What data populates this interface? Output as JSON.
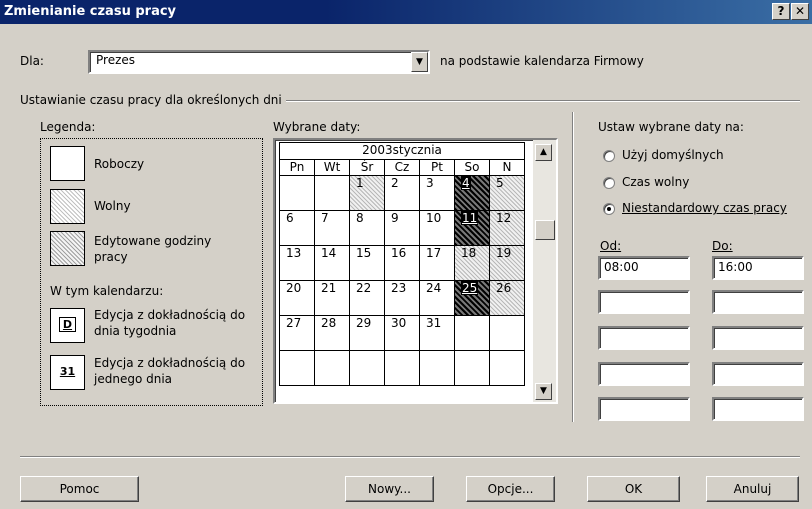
{
  "window": {
    "title": "Zmienianie czasu pracy",
    "help_btn": "?",
    "close_btn": "✕"
  },
  "for_row": {
    "label": "Dla:",
    "value": "Prezes",
    "based_on": "na podstawie kalendarza Firmowy"
  },
  "section_title": "Ustawianie czasu pracy dla określonych dni",
  "legend": {
    "title": "Legenda:",
    "working": "Roboczy",
    "nonworking": "Wolny",
    "edited_line1": "Edytowane godziny",
    "edited_line2": "pracy",
    "in_calendar": "W tym kalendarzu:",
    "day_of_week_sample": "D",
    "day_of_week_line1": "Edycja z dokładnością do",
    "day_of_week_line2": "dnia tygodnia",
    "single_day_sample": "31",
    "single_day_line1": "Edycja z dokładnością do",
    "single_day_line2": "jednego dnia"
  },
  "selected_dates": {
    "title": "Wybrane daty:",
    "month": "2003stycznia",
    "weekdays": [
      "Pn",
      "Wt",
      "Śr",
      "Cz",
      "Pt",
      "So",
      "N"
    ],
    "weeks": [
      [
        "",
        "",
        "1",
        "2",
        "3",
        "4",
        "5"
      ],
      [
        "6",
        "7",
        "8",
        "9",
        "10",
        "11",
        "12"
      ],
      [
        "13",
        "14",
        "15",
        "16",
        "17",
        "18",
        "19"
      ],
      [
        "20",
        "21",
        "22",
        "23",
        "24",
        "25",
        "26"
      ],
      [
        "27",
        "28",
        "29",
        "30",
        "31",
        "",
        ""
      ],
      [
        "",
        "",
        "",
        "",
        "",
        "",
        ""
      ]
    ]
  },
  "set_dates": {
    "title": "Ustaw wybrane daty na:",
    "opt_default": "Użyj domyślnych",
    "opt_nonworking": "Czas wolny",
    "opt_custom": "Niestandardowy czas pracy",
    "from_label": "Od:",
    "to_label": "Do:",
    "from_values": [
      "08:00",
      "",
      "",
      "",
      ""
    ],
    "to_values": [
      "16:00",
      "",
      "",
      "",
      ""
    ]
  },
  "buttons": {
    "help": "Pomoc",
    "new": "Nowy...",
    "options": "Opcje...",
    "ok": "OK",
    "cancel": "Anuluj"
  }
}
